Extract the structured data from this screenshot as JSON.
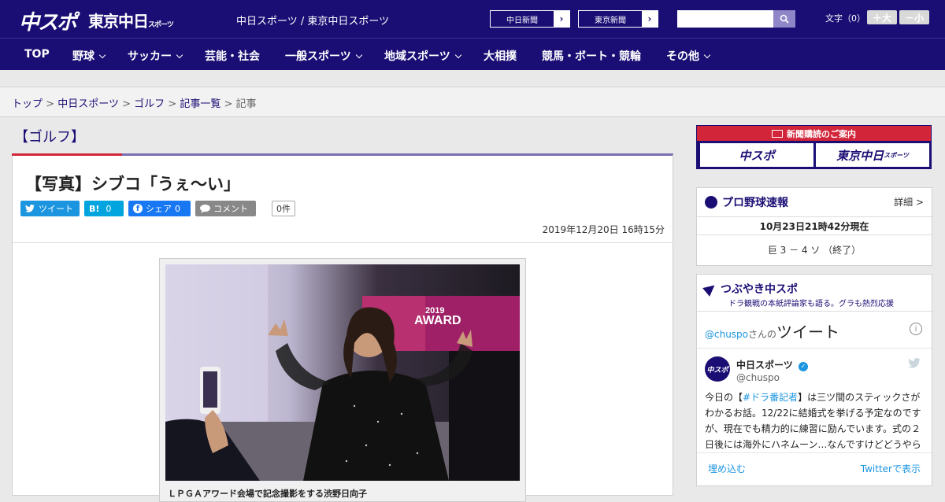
{
  "header": {
    "logo_chuspo": "中スポ",
    "logo_tokyo": "東京中日",
    "logo_tokyo_small": "スポーツ",
    "site_name": "中日スポーツ / 東京中日スポーツ",
    "links": [
      {
        "label": "中日新聞"
      },
      {
        "label": "東京新聞"
      }
    ],
    "search": {
      "placeholder": "",
      "value": ""
    },
    "fontsize": {
      "label": "文字（0）",
      "bigger": "＋大",
      "smaller": "－小"
    }
  },
  "nav": {
    "items": [
      {
        "label": "TOP",
        "dropdown": false
      },
      {
        "label": "野球",
        "dropdown": true
      },
      {
        "label": "サッカー",
        "dropdown": true
      },
      {
        "label": "芸能・社会",
        "dropdown": false
      },
      {
        "label": "一般スポーツ",
        "dropdown": true
      },
      {
        "label": "地域スポーツ",
        "dropdown": true
      },
      {
        "label": "大相撲",
        "dropdown": false
      },
      {
        "label": "競馬・ボート・競輪",
        "dropdown": false
      },
      {
        "label": "その他",
        "dropdown": true
      }
    ]
  },
  "breadcrumb": {
    "items": [
      "トップ",
      "中日スポーツ",
      "ゴルフ",
      "記事一覧"
    ],
    "separator": ">",
    "current": "記事"
  },
  "article": {
    "category": "【ゴルフ】",
    "headline": "【写真】シブコ「うぇ～い」",
    "share": {
      "tweet": "ツイート",
      "hatena": "B!",
      "hatena_count": "0",
      "facebook": "シェア",
      "facebook_count": "0",
      "comment": "コメント",
      "comment_count": "0件"
    },
    "date": "2019年12月20日 16時15分",
    "photo": {
      "backdrop_text_1": "2019",
      "backdrop_text_2": "AWARD",
      "caption": "ＬＰＧＡアワード会場で記念撮影をする渋野日向子"
    }
  },
  "sidebar": {
    "subscribe": {
      "title": "新聞購読のご案内",
      "btn1": "中スポ",
      "btn2": "東京中日",
      "btn2_small": "スポーツ"
    },
    "baseball": {
      "title": "プロ野球速報",
      "detail": "詳細 >",
      "datetime": "10月23日21時42分現在",
      "score": "巨 3 － 4 ソ （終了）"
    },
    "tweets": {
      "title": "つぶやき中スポ",
      "subtitle": "ドラ観戦の本紙評論家も語る。グラも熱烈応援",
      "handle_prefix": "@chuspo",
      "handle_suffix": "さんの",
      "tweets_label": "ツイート",
      "account_name": "中日スポーツ",
      "account_handle": "@chuspo",
      "avatar_text": "中スポ",
      "tweet_before": "今日の【",
      "tweet_hashtag": "#ドラ番記者",
      "tweet_after": "】は三ツ間のスティックさがわかるお話。12/22に結婚式を挙げる予定なのですが、現在でも精力的に練習に励んでいます。式の２日後には海外にハネムーン…なんですけどどうやら",
      "embed": "埋め込む",
      "view_on_twitter": "Twitterで表示"
    }
  },
  "colors": {
    "brand": "#1a0e74",
    "accent_red": "#d2253a",
    "twitter": "#1b95e0",
    "facebook": "#1877f2",
    "hatena": "#00a4de"
  }
}
